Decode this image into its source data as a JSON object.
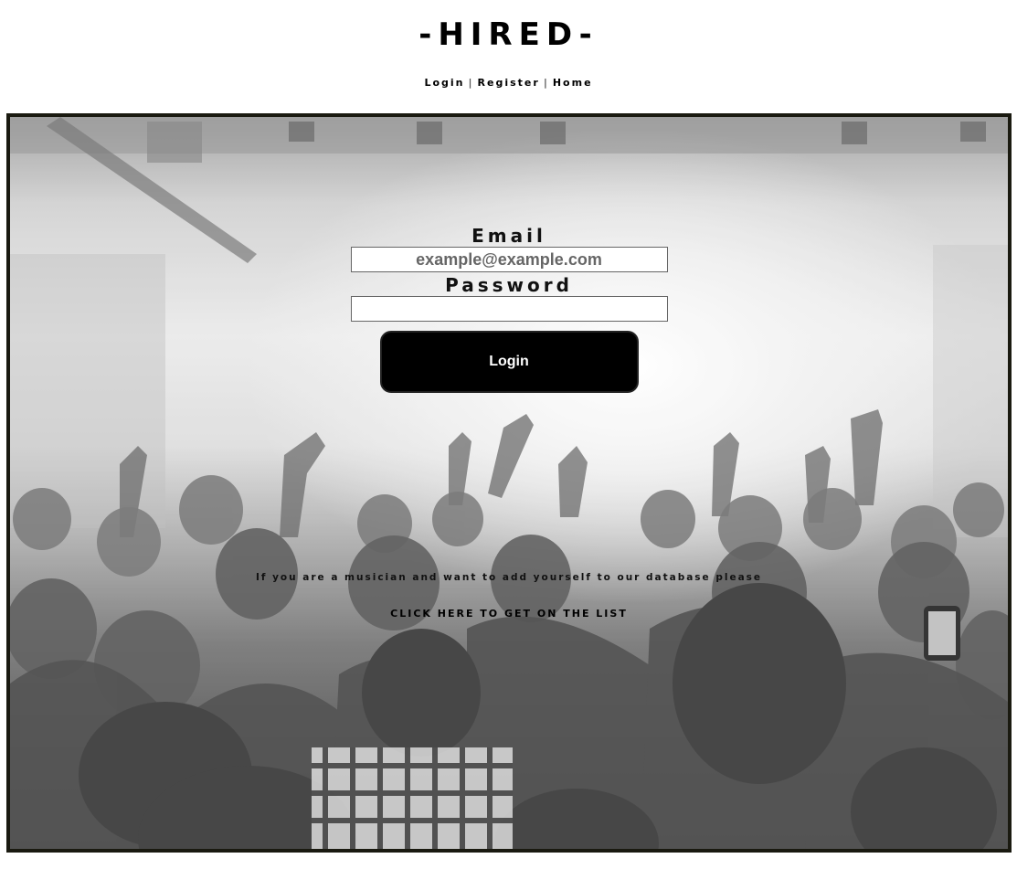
{
  "header": {
    "logo": "-HIRED-",
    "nav": {
      "login": "Login",
      "register": "Register",
      "home": "Home",
      "separator": "|"
    }
  },
  "login_form": {
    "email_label": "Email",
    "email_placeholder": "example@example.com",
    "email_value": "",
    "password_label": "Password",
    "password_value": "",
    "submit_label": "Login"
  },
  "promo": {
    "text": "If you are a musician and want to add yourself to our database please",
    "link_text": "CLICK HERE TO GET ON THE LIST"
  },
  "colors": {
    "background": "#ffffff",
    "frame_border": "#1a1a10",
    "button_bg": "#000000",
    "button_text": "#ffffff"
  },
  "background_image": "concert-crowd-photo"
}
